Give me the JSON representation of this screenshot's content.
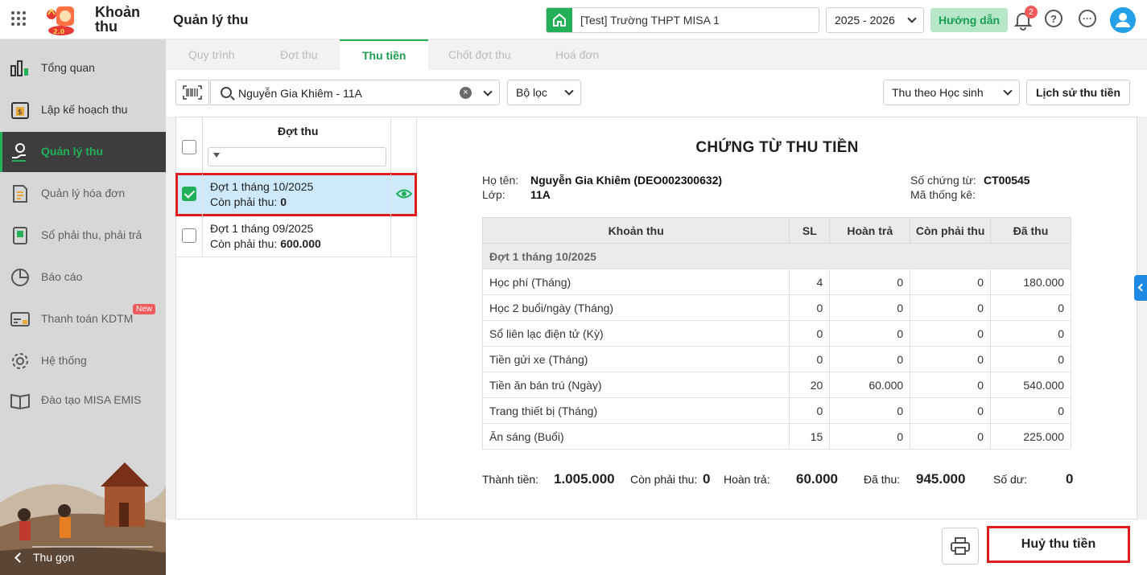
{
  "header": {
    "app_name_line1": "Khoản",
    "app_name_line2": "thu",
    "page_title": "Quản lý thu",
    "school": "[Test] Trường THPT MISA 1",
    "year": "2025 - 2026",
    "guide_label": "Hướng dẫn",
    "notification_count": "2",
    "help_symbol": "?",
    "more_symbol": "···"
  },
  "sidebar": {
    "items": [
      {
        "label": "Tổng quan",
        "icon": "bar-chart-icon"
      },
      {
        "label": "Lập kế hoạch thu",
        "icon": "calendar-money-icon"
      },
      {
        "label": "Quản lý thu",
        "icon": "hand-coin-icon",
        "active": true
      },
      {
        "label": "Quản lý hóa đơn",
        "icon": "invoice-icon"
      },
      {
        "label": "Sổ phải thu, phải trả",
        "icon": "ledger-icon"
      },
      {
        "label": "Báo cáo",
        "icon": "pie-chart-icon"
      },
      {
        "label": "Thanh toán KDTM",
        "icon": "payment-icon",
        "badge": "New"
      },
      {
        "label": "Hệ thống",
        "icon": "gear-icon"
      },
      {
        "label": "Đào tạo MISA EMIS",
        "icon": "book-icon"
      }
    ],
    "collapse_label": "Thu gọn"
  },
  "tabs": [
    {
      "label": "Quy trình"
    },
    {
      "label": "Đợt thu"
    },
    {
      "label": "Thu tiền",
      "active": true
    },
    {
      "label": "Chốt đợt thu"
    },
    {
      "label": "Hoá đơn"
    }
  ],
  "toolbar": {
    "search_value": "Nguyễn Gia Khiêm - 11A",
    "filter_label": "Bộ lọc",
    "mode_label": "Thu theo Học sinh",
    "history_label": "Lịch sử thu tiền",
    "clear_symbol": "×"
  },
  "batch_list": {
    "column_title": "Đợt thu",
    "rows": [
      {
        "name": "Đợt 1 tháng 10/2025",
        "remain_label": "Còn phải thu:",
        "remain_value": "0",
        "checked": true
      },
      {
        "name": "Đợt 1 tháng 09/2025",
        "remain_label": "Còn phải thu:",
        "remain_value": "600.000",
        "checked": false
      }
    ]
  },
  "voucher": {
    "title": "CHỨNG TỪ THU TIỀN",
    "name_label": "Họ tên:",
    "name_value": "Nguyễn Gia Khiêm (DEO002300632)",
    "class_label": "Lớp:",
    "class_value": "11A",
    "doc_no_label": "Số chứng từ:",
    "doc_no_value": "CT00545",
    "stat_code_label": "Mã thống kê:",
    "columns": [
      "Khoản thu",
      "SL",
      "Hoàn trả",
      "Còn phải thu",
      "Đã thu"
    ],
    "group_name": "Đợt 1 tháng 10/2025",
    "rows": [
      {
        "item": "Học phí (Tháng)",
        "qty": "4",
        "refund": "0",
        "remain": "0",
        "paid": "180.000"
      },
      {
        "item": "Học 2 buổi/ngày (Tháng)",
        "qty": "0",
        "refund": "0",
        "remain": "0",
        "paid": "0"
      },
      {
        "item": "Sổ liên lạc điện tử (Kỳ)",
        "qty": "0",
        "refund": "0",
        "remain": "0",
        "paid": "0"
      },
      {
        "item": "Tiền gửi xe (Tháng)",
        "qty": "0",
        "refund": "0",
        "remain": "0",
        "paid": "0"
      },
      {
        "item": "Tiền ăn bán trú (Ngày)",
        "qty": "20",
        "refund": "60.000",
        "remain": "0",
        "paid": "540.000"
      },
      {
        "item": "Trang thiết bị (Tháng)",
        "qty": "0",
        "refund": "0",
        "remain": "0",
        "paid": "0"
      },
      {
        "item": "Ăn sáng (Buổi)",
        "qty": "15",
        "refund": "0",
        "remain": "0",
        "paid": "225.000"
      }
    ],
    "summary": {
      "total_label": "Thành tiền:",
      "total_value": "1.005.000",
      "remain_label": "Còn phải thu:",
      "remain_value": "0",
      "refund_label": "Hoàn trả:",
      "refund_value": "60.000",
      "paid_label": "Đã thu:",
      "paid_value": "945.000",
      "balance_label": "Số dư:",
      "balance_value": "0"
    }
  },
  "footer": {
    "cancel_label": "Huỷ thu tiền"
  },
  "colors": {
    "accent": "#22b058",
    "selected_row": "#cde9fb",
    "highlight_border": "#e01b1b",
    "sidebar_bg": "#d7d7d7"
  }
}
